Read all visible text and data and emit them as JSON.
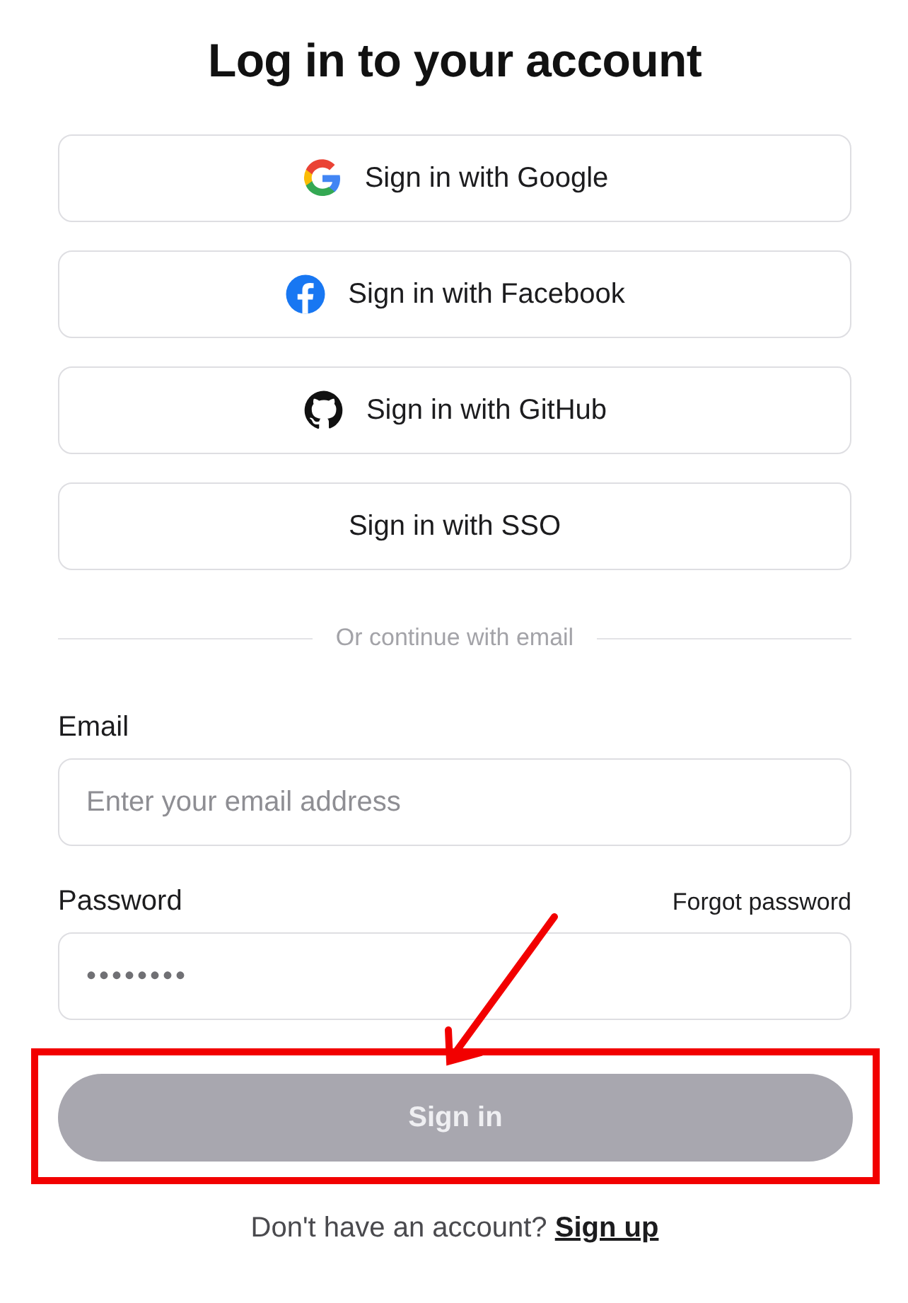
{
  "title": "Log in to your account",
  "providers": [
    {
      "kind": "google",
      "label": "Sign in with Google"
    },
    {
      "kind": "facebook",
      "label": "Sign in with Facebook"
    },
    {
      "kind": "github",
      "label": "Sign in with GitHub"
    },
    {
      "kind": "sso",
      "label": "Sign in with SSO"
    }
  ],
  "divider_text": "Or continue with email",
  "email": {
    "label": "Email",
    "placeholder": "Enter your email address"
  },
  "password": {
    "label": "Password",
    "forgot_link": "Forgot password",
    "value": "••••••••"
  },
  "submit": {
    "label": "Sign in",
    "disabled": true,
    "highlighted": true
  },
  "footer": {
    "text": "Don't have an account?",
    "link": "Sign up"
  }
}
